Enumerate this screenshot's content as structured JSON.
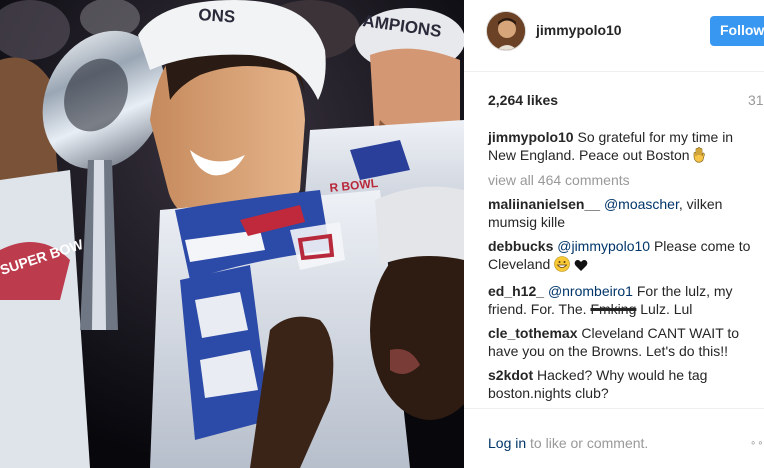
{
  "photo": {
    "cap_text_left": "ONS",
    "cap_text_right": "AMPIONS",
    "scarf_text_left": "SUPER BOW",
    "scarf_text_right": "R BOWL"
  },
  "post": {
    "username": "jimmypolo10",
    "follow_label": "Follow",
    "likes": "2,264 likes",
    "date_fragment": "31"
  },
  "caption": {
    "username": "jimmypolo10",
    "text": "So grateful for my time in New England. Peace out Boston"
  },
  "view_all": "view all 464 comments",
  "comments": [
    {
      "username": "maliinanielsen__",
      "mention": "@moascher",
      "text": ", vilken mumsig kille"
    },
    {
      "username": "debbucks",
      "mention": "@jimmypolo10",
      "text": " Please come to Cleveland"
    },
    {
      "username": "ed_h12_",
      "mention": "@nrombeiro1",
      "text_before": " For the lulz, my friend. For. The. ",
      "struck": "Fmking",
      "text_after": " Lulz. Lul"
    },
    {
      "username": "cle_tothemax",
      "text": "Cleveland CANT WAIT to have you on the Browns. Let's do this!!"
    },
    {
      "username": "s2kdot",
      "text": "Hacked? Why would he tag boston.nights club?"
    }
  ],
  "footer": {
    "login_link": "Log in",
    "login_rest": " to like or comment.",
    "more": "∘∘"
  },
  "icons": [
    "hand-icon",
    "grin-emoji-icon",
    "heart-icon",
    "more-options-icon"
  ]
}
